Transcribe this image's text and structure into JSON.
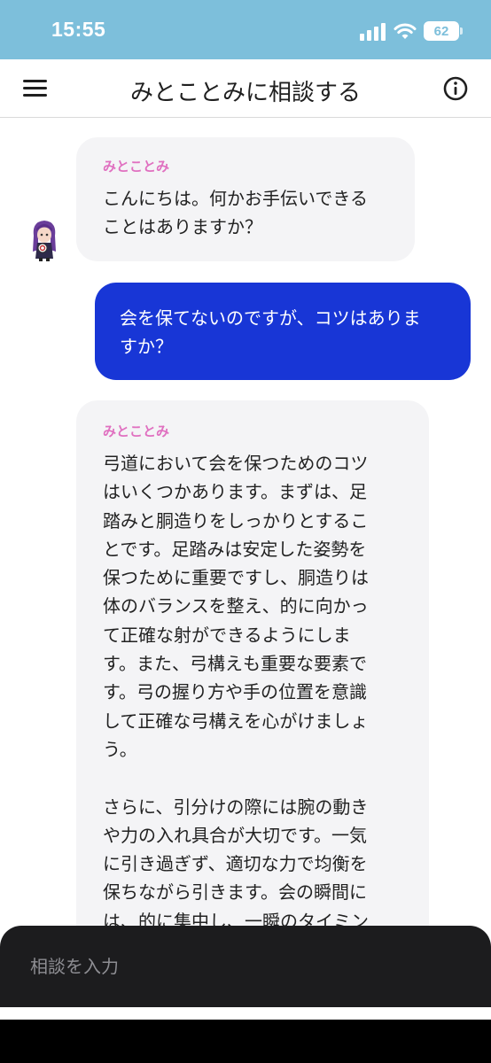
{
  "status_bar": {
    "time": "15:55",
    "battery": "62",
    "icons": [
      "signal-icon",
      "wifi-icon",
      "battery-icon"
    ]
  },
  "header": {
    "title": "みとことみに相談する",
    "menu_icon": "hamburger-menu-icon",
    "info_icon": "info-icon"
  },
  "messages": [
    {
      "role": "bot",
      "sender": "みとことみ",
      "text": "こんにちは。何かお手伝いできる\nことはありますか？"
    },
    {
      "role": "user",
      "text": "会を保てないのですが、コツはありま\nすか？"
    },
    {
      "role": "bot",
      "sender": "みとことみ",
      "text": "弓道において会を保つためのコツ\nはいくつかあります。まずは、足\n踏みと胴造りをしっかりとするこ\nとです。足踏みは安定した姿勢を\n保つために重要ですし、胴造りは\n体のバランスを整え、的に向かっ\nて正確な射ができるようにしま\nす。また、弓構えも重要な要素で\nす。弓の握り方や手の位置を意識\nして正確な弓構えを心がけましょ\nう。\n\nさらに、引分けの際には腕の動き\nや力の入れ具合が大切です。一気\nに引き過ぎず、適切な力で均衡を\n保ちながら引きます。会の瞬間に\nは、的に集中し、一瞬のタイミン"
    }
  ],
  "input": {
    "placeholder": "相談を入力",
    "value": ""
  },
  "colors": {
    "status_bar": "#7dbfdb",
    "user_bubble": "#1836d6",
    "bot_bubble": "#f4f4f6",
    "sender_name": "#e070c0",
    "input_bar": "#1c1c1e"
  }
}
